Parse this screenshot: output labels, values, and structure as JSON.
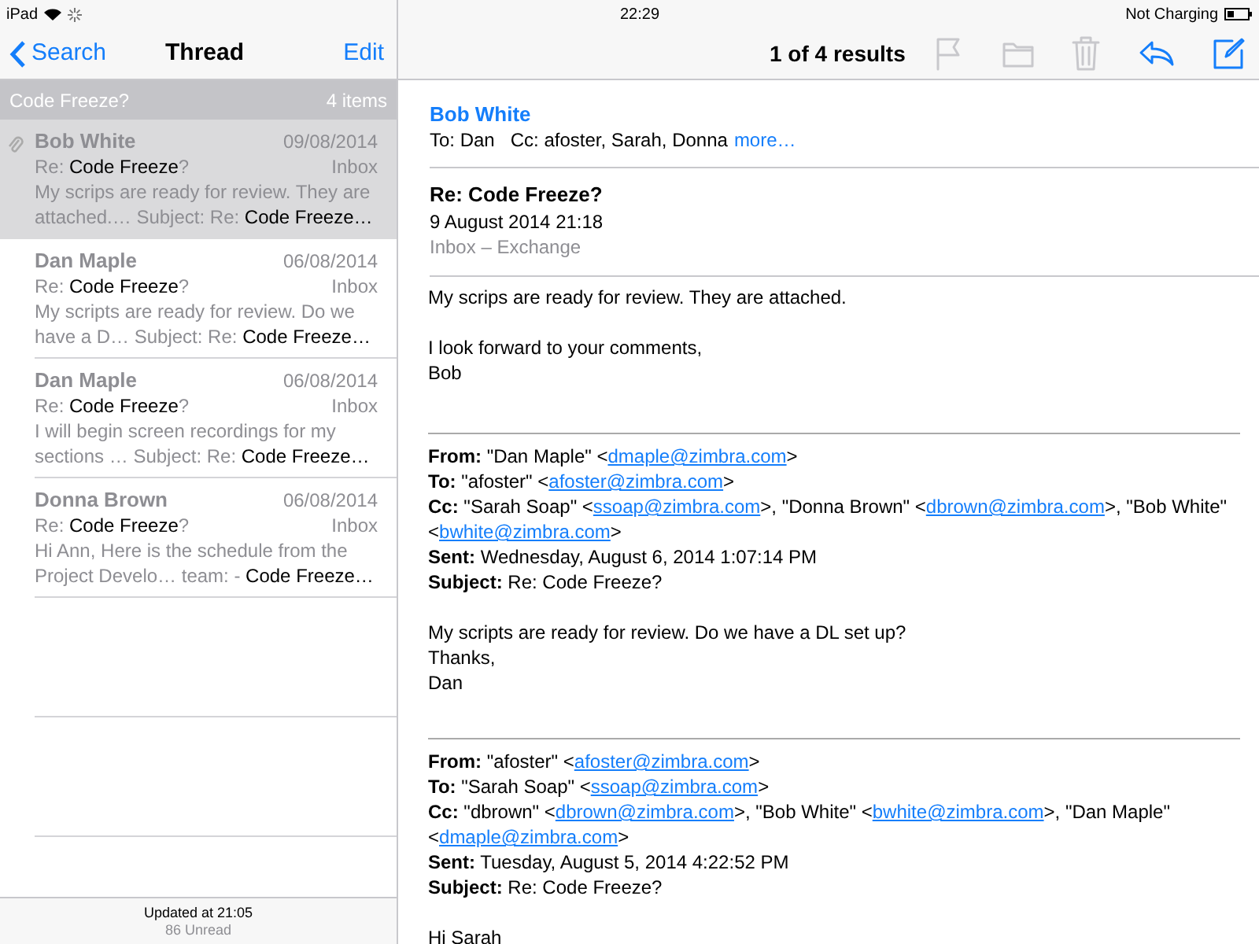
{
  "status_bar": {
    "device": "iPad",
    "time": "22:29",
    "battery_text": "Not Charging"
  },
  "list_nav": {
    "back": "Search",
    "title": "Thread",
    "edit": "Edit"
  },
  "thread_header": {
    "title": "Code Freeze?",
    "count": "4 items"
  },
  "messages": [
    {
      "sender": "Bob White",
      "date": "09/08/2014",
      "folder": "Inbox",
      "subject_before": "Re: ",
      "subject_match": "Code Freeze",
      "subject_after": "?",
      "preview_before": "My scrips are ready for review. They are attached.… Subject: Re: ",
      "preview_match": "Code Freeze…",
      "selected": true,
      "attachment": true
    },
    {
      "sender": "Dan Maple",
      "date": "06/08/2014",
      "folder": "Inbox",
      "subject_before": "Re: ",
      "subject_match": "Code Freeze",
      "subject_after": "?",
      "preview_before": "My scripts are ready for review. Do we have a D… Subject: Re: ",
      "preview_match": "Code Freeze…",
      "selected": false,
      "attachment": false
    },
    {
      "sender": "Dan Maple",
      "date": "06/08/2014",
      "folder": "Inbox",
      "subject_before": "Re: ",
      "subject_match": "Code Freeze",
      "subject_after": "?",
      "preview_before": "I will begin screen recordings for my sections … Subject: Re: ",
      "preview_match": "Code Freeze…",
      "selected": false,
      "attachment": false
    },
    {
      "sender": "Donna Brown",
      "date": "06/08/2014",
      "folder": "Inbox",
      "subject_before": "Re: ",
      "subject_match": "Code Freeze",
      "subject_after": "?",
      "preview_before": "Hi Ann, Here is the schedule from the Project Develo… team: - ",
      "preview_match": "Code Freeze…",
      "selected": false,
      "attachment": false
    }
  ],
  "list_footer": {
    "updated": "Updated at 21:05",
    "unread": "86 Unread"
  },
  "toolbar": {
    "results": "1 of 4 results",
    "buttons": [
      {
        "kind": "flag",
        "disabled": true
      },
      {
        "kind": "folder",
        "disabled": true
      },
      {
        "kind": "trash",
        "disabled": true
      },
      {
        "kind": "reply",
        "disabled": false
      },
      {
        "kind": "compose",
        "disabled": false
      }
    ]
  },
  "message": {
    "from": "Bob White",
    "to": "To: Dan",
    "cc": "Cc: afoster, Sarah, Donna",
    "more": "more…",
    "subject": "Re: Code Freeze?",
    "date": "9 August 2014 21:18",
    "mailbox": "Inbox – Exchange",
    "body": [
      "My scrips are ready for review. They are attached.",
      "I look forward to your comments,\nBob"
    ],
    "quoted": [
      {
        "headers": [
          {
            "label": "From:",
            "parts": [
              {
                "kind": "text",
                "text": " \"Dan Maple\" <"
              },
              {
                "kind": "link",
                "text": "dmaple@zimbra.com"
              },
              {
                "kind": "text",
                "text": ">"
              }
            ]
          },
          {
            "label": "To:",
            "parts": [
              {
                "kind": "text",
                "text": " \"afoster\" <"
              },
              {
                "kind": "link",
                "text": "afoster@zimbra.com"
              },
              {
                "kind": "text",
                "text": ">"
              }
            ]
          },
          {
            "label": "Cc:",
            "parts": [
              {
                "kind": "text",
                "text": " \"Sarah Soap\" <"
              },
              {
                "kind": "link",
                "text": "ssoap@zimbra.com"
              },
              {
                "kind": "text",
                "text": ">, \"Donna Brown\" <"
              },
              {
                "kind": "link",
                "text": "dbrown@zimbra.com"
              },
              {
                "kind": "text",
                "text": ">, \"Bob White\" <"
              },
              {
                "kind": "link",
                "text": "bwhite@zimbra.com"
              },
              {
                "kind": "text",
                "text": ">"
              }
            ]
          },
          {
            "label": "Sent:",
            "parts": [
              {
                "kind": "text",
                "text": " Wednesday, August 6, 2014 1:07:14 PM"
              }
            ]
          },
          {
            "label": "Subject:",
            "parts": [
              {
                "kind": "text",
                "text": " Re: Code Freeze?"
              }
            ]
          }
        ],
        "body": "My scripts are ready for review. Do we have a DL set up?\nThanks,\nDan"
      },
      {
        "headers": [
          {
            "label": "From:",
            "parts": [
              {
                "kind": "text",
                "text": " \"afoster\" <"
              },
              {
                "kind": "link",
                "text": "afoster@zimbra.com"
              },
              {
                "kind": "text",
                "text": ">"
              }
            ]
          },
          {
            "label": "To:",
            "parts": [
              {
                "kind": "text",
                "text": " \"Sarah Soap\" <"
              },
              {
                "kind": "link",
                "text": "ssoap@zimbra.com"
              },
              {
                "kind": "text",
                "text": ">"
              }
            ]
          },
          {
            "label": "Cc:",
            "parts": [
              {
                "kind": "text",
                "text": " \"dbrown\" <"
              },
              {
                "kind": "link",
                "text": "dbrown@zimbra.com"
              },
              {
                "kind": "text",
                "text": ">, \"Bob White\" <"
              },
              {
                "kind": "link",
                "text": "bwhite@zimbra.com"
              },
              {
                "kind": "text",
                "text": ">, \"Dan Maple\" <"
              },
              {
                "kind": "link",
                "text": "dmaple@zimbra.com"
              },
              {
                "kind": "text",
                "text": ">"
              }
            ]
          },
          {
            "label": "Sent:",
            "parts": [
              {
                "kind": "text",
                "text": " Tuesday, August 5, 2014 4:22:52 PM"
              }
            ]
          },
          {
            "label": "Subject:",
            "parts": [
              {
                "kind": "text",
                "text": " Re: Code Freeze?"
              }
            ]
          }
        ],
        "body": "Hi Sarah"
      }
    ]
  }
}
